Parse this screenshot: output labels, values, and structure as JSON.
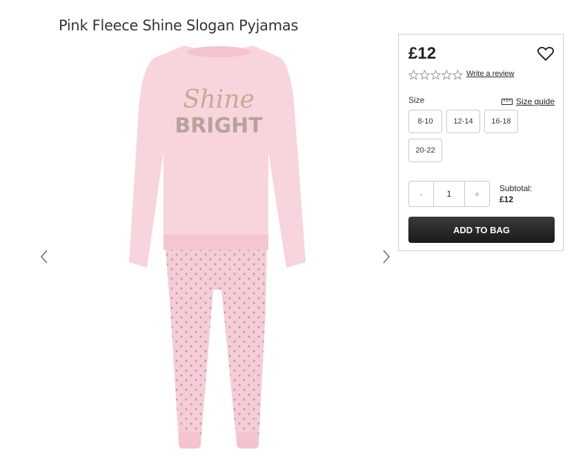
{
  "product": {
    "title": "Pink Fleece Shine Slogan Pyjamas",
    "image_alt": "Pink Fleece Shine Slogan Pyjamas",
    "slogan_line1": "Shine",
    "slogan_line2": "BRIGHT"
  },
  "gallery": {
    "prev_icon": "chevron-left-icon",
    "next_icon": "chevron-right-icon"
  },
  "purchase": {
    "price": "£12",
    "rating_stars": 0,
    "write_review": "Write a review",
    "size_label": "Size",
    "size_guide": "Size guide",
    "sizes": [
      "8-10",
      "12-14",
      "16-18",
      "20-22"
    ],
    "qty_minus": "-",
    "qty_value": "1",
    "qty_plus": "+",
    "subtotal_label": "Subtotal:",
    "subtotal_value": "£12",
    "add_to_bag": "ADD TO BAG"
  },
  "colors": {
    "pyjama_pink": "#f6cdd6",
    "button_dark": "#222222"
  }
}
